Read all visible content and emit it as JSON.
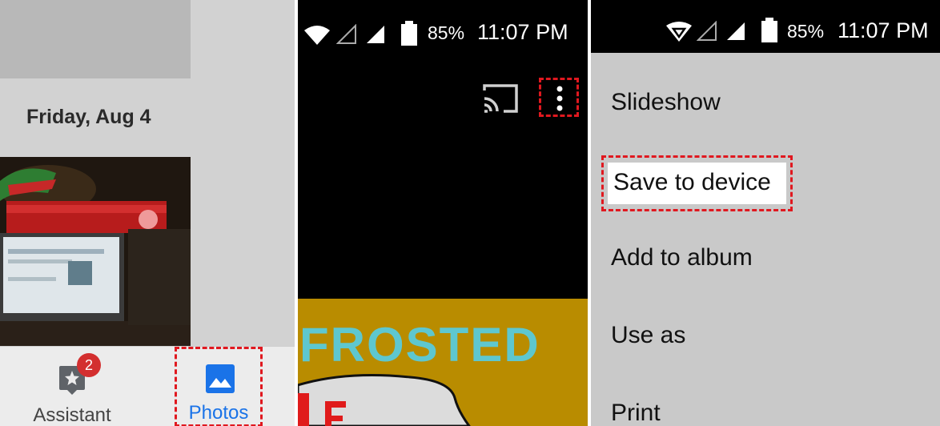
{
  "panel1": {
    "date_header": "Friday, Aug 4",
    "nav": {
      "assistant_label": "Assistant",
      "assistant_badge": "2",
      "photos_label": "Photos"
    },
    "colors": {
      "accent": "#1a73e8",
      "badge": "#d32f2f",
      "highlight": "#e0181f"
    }
  },
  "panel2": {
    "status": {
      "battery": "85%",
      "time": "11:07 PM"
    },
    "image_text": "FROSTED"
  },
  "panel3": {
    "status": {
      "battery": "85%",
      "time": "11:07 PM"
    },
    "menu": [
      "Slideshow",
      "Save to device",
      "Add to album",
      "Use as",
      "Print"
    ]
  }
}
